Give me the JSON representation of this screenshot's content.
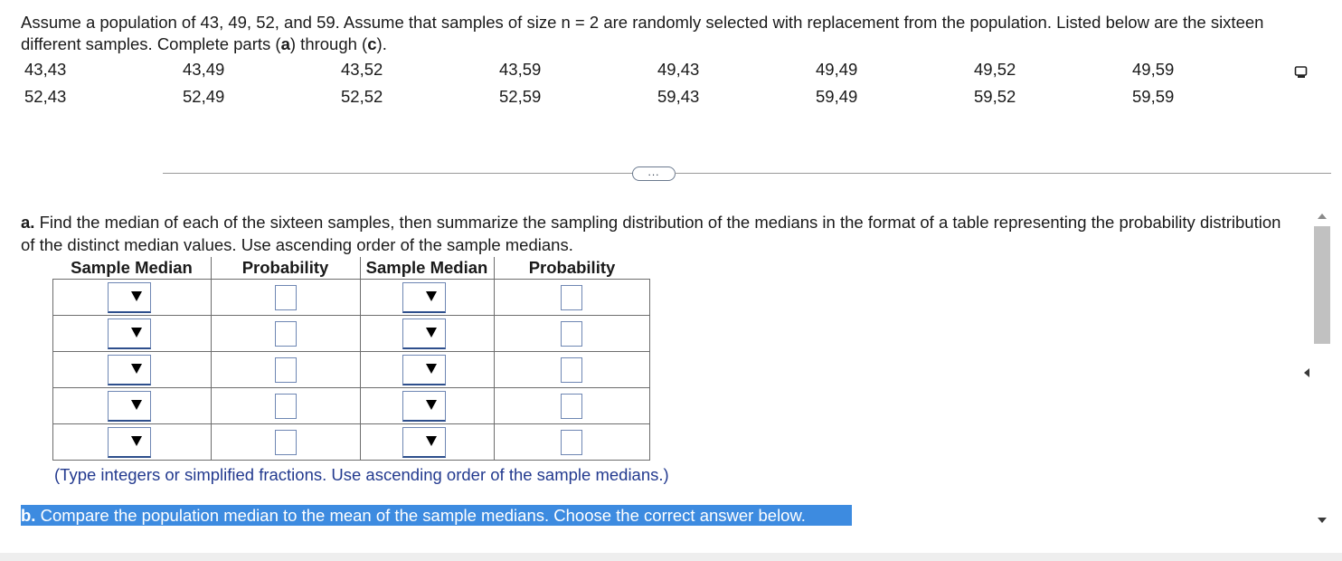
{
  "problem": {
    "intro_1": "Assume a population of 43, 49, 52, and 59. Assume that samples of size n",
    "equals_n": " = 2 ",
    "intro_2": "are randomly selected with replacement from the population. Listed below are the sixteen different samples. Complete parts (",
    "part_a_letter": "a",
    "through": ") through (",
    "part_c_letter": "c",
    "end": ")."
  },
  "samples": {
    "row1": [
      "43,43",
      "43,49",
      "43,52",
      "43,59",
      "49,43",
      "49,49",
      "49,52",
      "49,59"
    ],
    "row2": [
      "52,43",
      "52,49",
      "52,52",
      "52,59",
      "59,43",
      "59,49",
      "59,52",
      "59,59"
    ]
  },
  "expand_button": "...",
  "part_a": {
    "letter": "a.",
    "text": " Find the median of each of the sixteen samples, then summarize the sampling distribution of the medians in the format of a table representing the probability distribution of the distinct median values. Use ascending order of the sample medians."
  },
  "table": {
    "headers": [
      "Sample Median",
      "Probability",
      "Sample Median",
      "Probability"
    ]
  },
  "note": "(Type integers or simplified fractions. Use ascending order of the sample medians.)",
  "part_b": {
    "letter": "b.",
    "text": " Compare the population median to the mean of the sample medians. Choose the correct answer below."
  },
  "colors": {
    "highlight": "#3d8be0",
    "note_text": "#233a8f",
    "input_border": "#6e86b3"
  },
  "icons": {
    "copy": "copy-icon",
    "dropdown": "chevron-down-icon"
  }
}
